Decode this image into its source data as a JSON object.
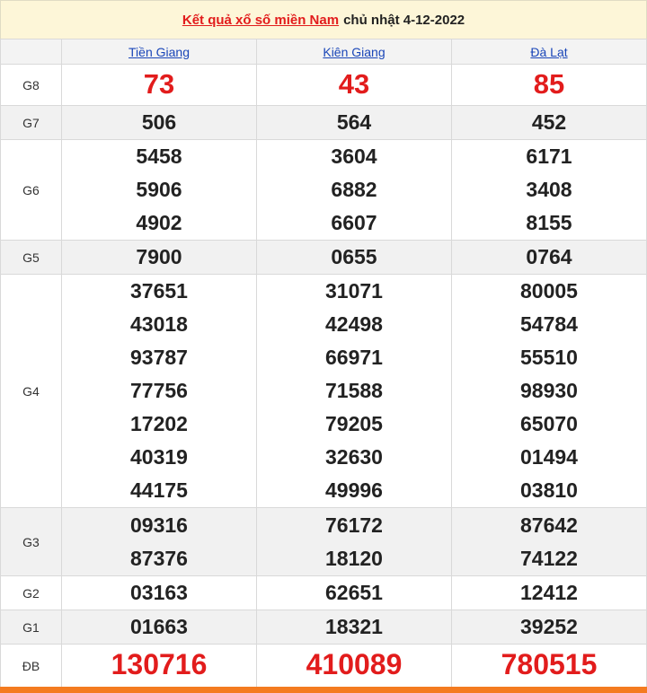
{
  "title": {
    "link": "Kết quả xổ số miền Nam",
    "suffix": "chủ nhật 4-12-2022"
  },
  "columns": [
    "Tiền Giang",
    "Kiên Giang",
    "Đà Lạt"
  ],
  "prizes": [
    {
      "label": "G8",
      "values": [
        [
          "73"
        ],
        [
          "43"
        ],
        [
          "85"
        ]
      ]
    },
    {
      "label": "G7",
      "values": [
        [
          "506"
        ],
        [
          "564"
        ],
        [
          "452"
        ]
      ]
    },
    {
      "label": "G6",
      "values": [
        [
          "5458",
          "5906",
          "4902"
        ],
        [
          "3604",
          "6882",
          "6607"
        ],
        [
          "6171",
          "3408",
          "8155"
        ]
      ]
    },
    {
      "label": "G5",
      "values": [
        [
          "7900"
        ],
        [
          "0655"
        ],
        [
          "0764"
        ]
      ]
    },
    {
      "label": "G4",
      "values": [
        [
          "37651",
          "43018",
          "93787",
          "77756",
          "17202",
          "40319",
          "44175"
        ],
        [
          "31071",
          "42498",
          "66971",
          "71588",
          "79205",
          "32630",
          "49996"
        ],
        [
          "80005",
          "54784",
          "55510",
          "98930",
          "65070",
          "01494",
          "03810"
        ]
      ]
    },
    {
      "label": "G3",
      "values": [
        [
          "09316",
          "87376"
        ],
        [
          "76172",
          "18120"
        ],
        [
          "87642",
          "74122"
        ]
      ]
    },
    {
      "label": "G2",
      "values": [
        [
          "03163"
        ],
        [
          "62651"
        ],
        [
          "12412"
        ]
      ]
    },
    {
      "label": "G1",
      "values": [
        [
          "01663"
        ],
        [
          "18321"
        ],
        [
          "39252"
        ]
      ]
    },
    {
      "label": "ĐB",
      "values": [
        [
          "130716"
        ],
        [
          "410089"
        ],
        [
          "780515"
        ]
      ]
    }
  ],
  "colors": {
    "accent": "#e21c1c",
    "link": "#1a46b8",
    "bottom_bar": "#f47b20"
  }
}
